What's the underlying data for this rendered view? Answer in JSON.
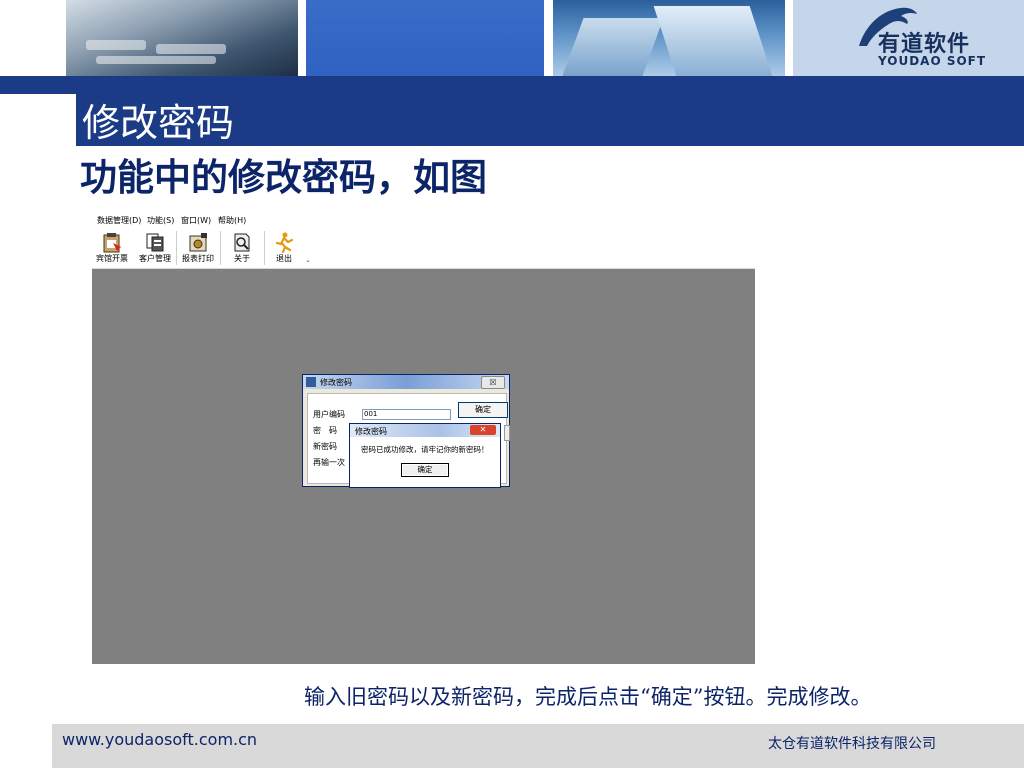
{
  "slide": {
    "title": "修改密码",
    "subtitle": "功能中的修改密码，如图",
    "caption": "输入旧密码以及新密码，完成后点击“确定”按钮。完成修改。"
  },
  "logo": {
    "cn": "有道软件",
    "en": "YOUDAO SOFT"
  },
  "app": {
    "menu": [
      {
        "label": "数据管理(D)"
      },
      {
        "label": "功能(S)"
      },
      {
        "label": "窗口(W)"
      },
      {
        "label": "帮助(H)"
      }
    ],
    "toolbar": [
      {
        "label": "宾馆开票",
        "icon": "clipboard-icon"
      },
      {
        "label": "客户管理",
        "icon": "documents-icon"
      },
      {
        "label": "报表打印",
        "icon": "printer-icon"
      },
      {
        "label": "关于",
        "icon": "help-icon"
      },
      {
        "label": "退出",
        "icon": "exit-icon"
      }
    ],
    "dialog": {
      "title": "修改密码",
      "close": "☒",
      "fields": [
        "用户编码",
        "密　码",
        "新密码",
        "再输一次"
      ],
      "user_code_value": "001",
      "ok_label": "确定"
    },
    "message": {
      "title": "修改密码",
      "close": "✕",
      "text": "密码已成功修改，请牢记你的新密码！",
      "ok_label": "确定"
    }
  },
  "footer": {
    "url": "www.youdaosoft.com.cn",
    "company": "太仓有道软件科技有限公司"
  },
  "colors": {
    "banner": "#1b3b86",
    "title_text": "#0c2468",
    "app_background": "#808080",
    "footer_bg": "#d9d9d9"
  }
}
